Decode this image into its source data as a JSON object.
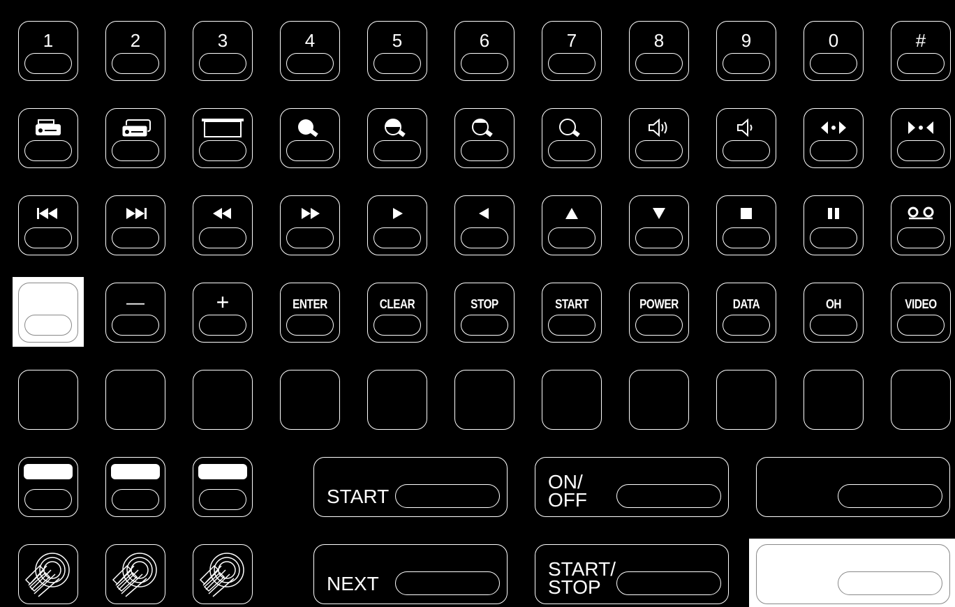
{
  "row1": [
    "1",
    "2",
    "3",
    "4",
    "5",
    "6",
    "7",
    "8",
    "9",
    "0",
    "#"
  ],
  "row2_icons": [
    "tape-deck-icon",
    "dual-tape-deck-icon",
    "screen-icon",
    "bulb-full-icon",
    "bulb-half-icon",
    "bulb-low-icon",
    "bulb-off-icon",
    "volume-up-icon",
    "volume-down-icon",
    "expand-arrows-icon",
    "collapse-arrows-icon"
  ],
  "row3_icons": [
    "skip-back-icon",
    "skip-forward-icon",
    "rewind-icon",
    "fast-forward-icon",
    "play-icon",
    "reverse-play-icon",
    "up-arrow-icon",
    "down-arrow-icon",
    "stop-square-icon",
    "pause-icon",
    "cassette-reel-icon"
  ],
  "row4": [
    "",
    "—",
    "+",
    "ENTER",
    "CLEAR",
    "STOP",
    "START",
    "POWER",
    "DATA",
    "OH",
    "VIDEO"
  ],
  "wide": {
    "start": "START",
    "onoff_1": "ON/",
    "onoff_2": "OFF",
    "next": "NEXT",
    "startstop_1": "START/",
    "startstop_2": "STOP"
  },
  "row7_icons": [
    "keypad-stack-icon",
    "keypad-stack-icon",
    "keypad-stack-icon"
  ]
}
